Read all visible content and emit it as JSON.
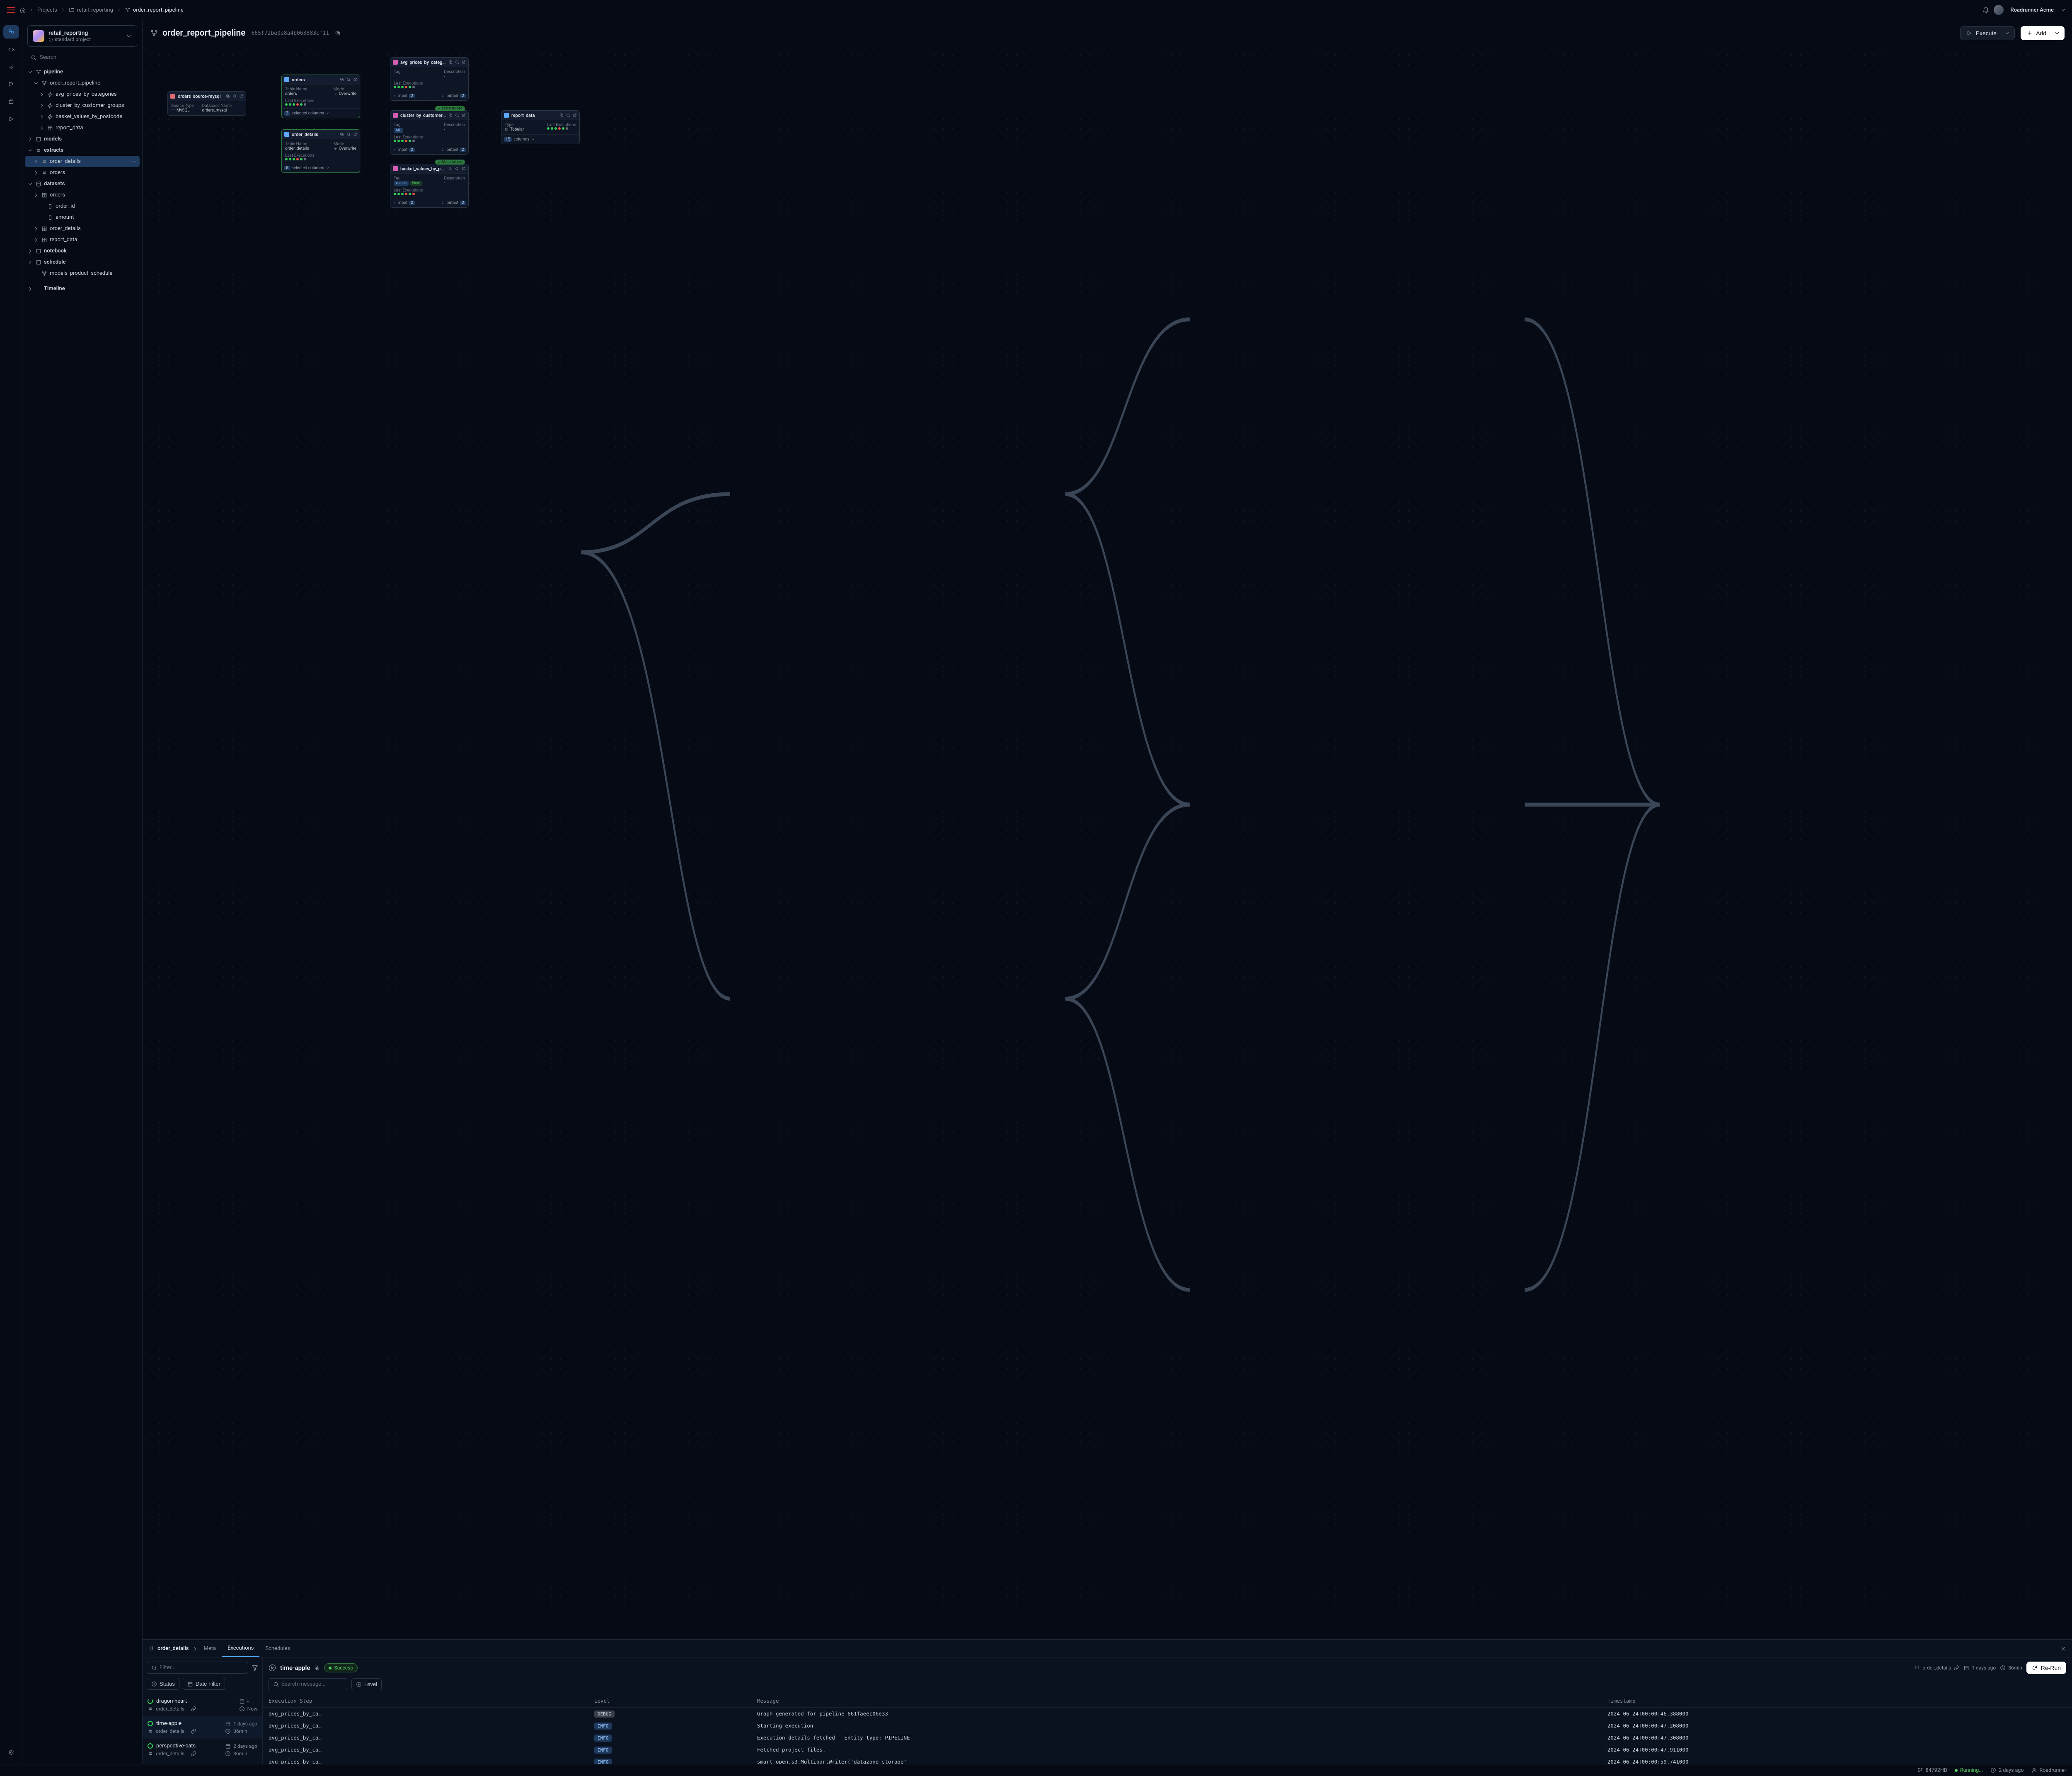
{
  "org": "Roadrunner Acme",
  "breadcrumbs": {
    "home": "home",
    "projects": "Projects",
    "proj": "retail_reporting",
    "leaf": "order_report_pipeline"
  },
  "project": {
    "name": "retail_reporting",
    "subtitle": "standard project"
  },
  "search": {
    "placeholder": "Search"
  },
  "header": {
    "title": "order_report_pipeline",
    "hash": "665f72be0e8a4b063883cf11",
    "execute": "Execute",
    "add": "Add"
  },
  "tree": {
    "pipeline": "pipeline",
    "pipeline_root": "order_report_pipeline",
    "pipeline_children": [
      "avg_prices_by_categories",
      "cluster_by_customer_groups",
      "basket_values_by_postcode",
      "report_data"
    ],
    "models": "models",
    "extracts": "extracts",
    "extracts_children": [
      "order_details",
      "orders"
    ],
    "datasets": "datasets",
    "datasets_orders": "orders",
    "datasets_orders_cols": [
      "order_id",
      "amount"
    ],
    "datasets_rest": [
      "order_details",
      "report_data"
    ],
    "notebook": "notebook",
    "schedule": "schedule",
    "schedule_child": "models_product_schedule",
    "timeline": "Timeline"
  },
  "canvas": {
    "source": {
      "title": "orders_source-mysql",
      "k1": "Source Type",
      "v1": "MySQL",
      "k2": "Database Name",
      "v2": "orders_mysql"
    },
    "orders": {
      "title": "orders",
      "tn": "Table Name",
      "tnv": "orders",
      "mode": "Mode",
      "modev": "Overwrite",
      "le": "Last Executions",
      "ft": "selected columns",
      "ftn": "2"
    },
    "order_details": {
      "title": "order_details",
      "tnv": "order_details",
      "modev": "Overwrite",
      "ft": "selected columns",
      "ftn": "5"
    },
    "avg": {
      "title": "avg_prices_by_categories",
      "tag": "Tag",
      "desc": "Description",
      "descv": "-",
      "le": "Last Executions",
      "in": "input",
      "out": "output",
      "n": "2"
    },
    "cluster": {
      "title": "cluster_by_customer_groups",
      "ml": "ML"
    },
    "basket": {
      "title": "basket_values_by_postcode",
      "t1": "values",
      "t2": "New"
    },
    "report": {
      "title": "report_data",
      "type": "Type",
      "typev": "Tabular",
      "cols": "columns",
      "colsn": "15",
      "le": "Last Executions"
    },
    "materialized": "Materialized"
  },
  "panel": {
    "crumb": "order_details",
    "tabs": {
      "meta": "Meta",
      "executions": "Executions",
      "schedules": "Schedules"
    },
    "filter_placeholder": "Filter...",
    "status": "Status",
    "date_filter": "Date Filter",
    "search_msg": "Search message...",
    "level": "Level",
    "rerun": "Re-Run",
    "run": {
      "name": "time-apple",
      "status": "Success",
      "scope": "order_details",
      "when": "1 days ago",
      "dur": "36min"
    },
    "execs": [
      {
        "name": "dragon-heart",
        "status": "running",
        "scope": "order_details",
        "when": "-",
        "dur": "Now"
      },
      {
        "name": "time-apple",
        "status": "ok",
        "scope": "order_details",
        "when": "1 days ago",
        "dur": "36min"
      },
      {
        "name": "perspective-cats",
        "status": "ok",
        "scope": "order_details",
        "when": "2 days ago",
        "dur": "36min"
      }
    ],
    "cols": {
      "step": "Execution Step",
      "level": "Level",
      "msg": "Message",
      "ts": "Timestamp"
    },
    "logs": [
      {
        "step": "avg_prices_by_ca…",
        "lvl": "DEBUG",
        "msg": "Graph generated for pipeline 661faeec06e33",
        "ts": "2024-06-24T00:00:46.388000"
      },
      {
        "step": "avg_prices_by_ca…",
        "lvl": "INFO",
        "msg": "Starting execution",
        "ts": "2024-06-24T00:00:47.208000"
      },
      {
        "step": "avg_prices_by_ca…",
        "lvl": "INFO",
        "msg": "Execution details fetched - Entity type: PIPELINE",
        "ts": "2024-06-24T00:00:47.308000"
      },
      {
        "step": "avg_prices_by_ca…",
        "lvl": "INFO",
        "msg": "Fetched project files.",
        "ts": "2024-06-24T00:00:47.911000"
      },
      {
        "step": "avg_prices_by_ca…",
        "lvl": "INFO",
        "msg": "smart_open.s3.MultipartWriter('datazone-storage'",
        "ts": "2024-06-24T00:00:59.741000"
      }
    ]
  },
  "status": {
    "branch": "84792HD",
    "state": "Running...",
    "age": "2 days ago",
    "user": "Roadrunner"
  }
}
